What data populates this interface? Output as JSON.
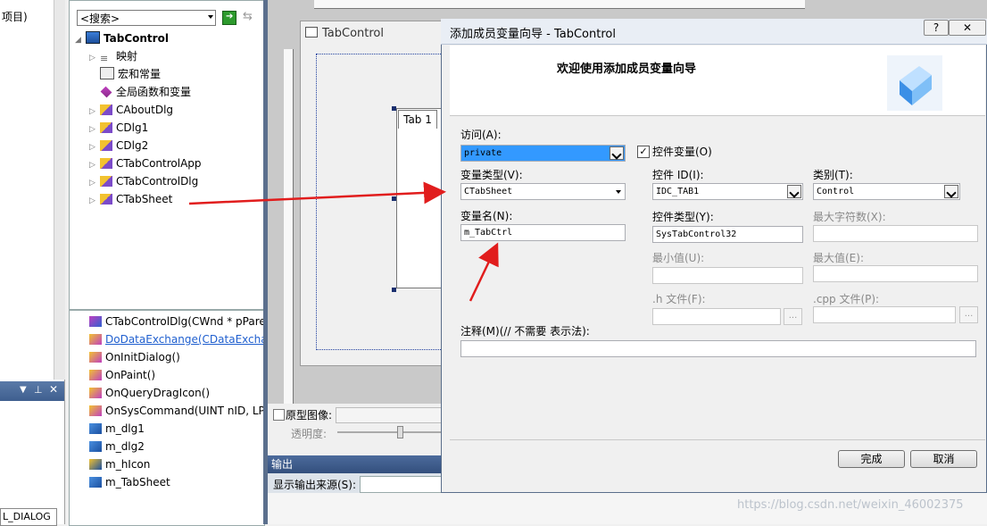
{
  "left_pane": {
    "project_text": "项目)",
    "bottom_tab": "L_DIALOG"
  },
  "classview": {
    "search_placeholder": "<搜索>",
    "tree": [
      {
        "label": "TabControl",
        "bold": true
      },
      {
        "label": "映射"
      },
      {
        "label": "宏和常量"
      },
      {
        "label": "全局函数和变量"
      },
      {
        "label": "CAboutDlg"
      },
      {
        "label": "CDlg1"
      },
      {
        "label": "CDlg2"
      },
      {
        "label": "CTabControlApp"
      },
      {
        "label": "CTabControlDlg"
      },
      {
        "label": "CTabSheet"
      }
    ]
  },
  "members": [
    "CTabControlDlg(CWnd * pPare",
    "DoDataExchange(CDataExchan",
    "OnInitDialog()",
    "OnPaint()",
    "OnQueryDragIcon()",
    "OnSysCommand(UINT nID, LPA",
    "m_dlg1",
    "m_dlg2",
    "m_hIcon",
    "m_TabSheet"
  ],
  "designer": {
    "window_title": "TabControl",
    "tab_label": "Tab 1",
    "proto_label": "原型图像:",
    "opacity_label": "透明度:"
  },
  "output": {
    "title": "输出",
    "source_label": "显示输出来源(S):"
  },
  "dialog": {
    "title": "添加成员变量向导 - TabControl",
    "help": "?",
    "close": "✕",
    "welcome": "欢迎使用添加成员变量向导",
    "access_label": "访问(A):",
    "access_value": "private",
    "control_var_label": "控件变量(O)",
    "control_var_checked": true,
    "var_type_label": "变量类型(V):",
    "var_type_value": "CTabSheet",
    "control_id_label": "控件 ID(I):",
    "control_id_value": "IDC_TAB1",
    "category_label": "类别(T):",
    "category_value": "Control",
    "var_name_label": "变量名(N):",
    "var_name_value": "m_TabCtrl",
    "control_type_label": "控件类型(Y):",
    "control_type_value": "SysTabControl32",
    "max_chars_label": "最大字符数(X):",
    "min_label": "最小值(U):",
    "max_label": "最大值(E):",
    "h_file_label": ".h 文件(F):",
    "cpp_file_label": ".cpp 文件(P):",
    "browse": "...",
    "comment_label": "注释(M)(// 不需要 表示法):",
    "finish": "完成",
    "cancel": "取消"
  },
  "watermark": "https://blog.csdn.net/weixin_46002375",
  "colors": {
    "arrow": "#e11d1d",
    "selection": "#3399ff",
    "panel_header": "#3f5f8f"
  }
}
